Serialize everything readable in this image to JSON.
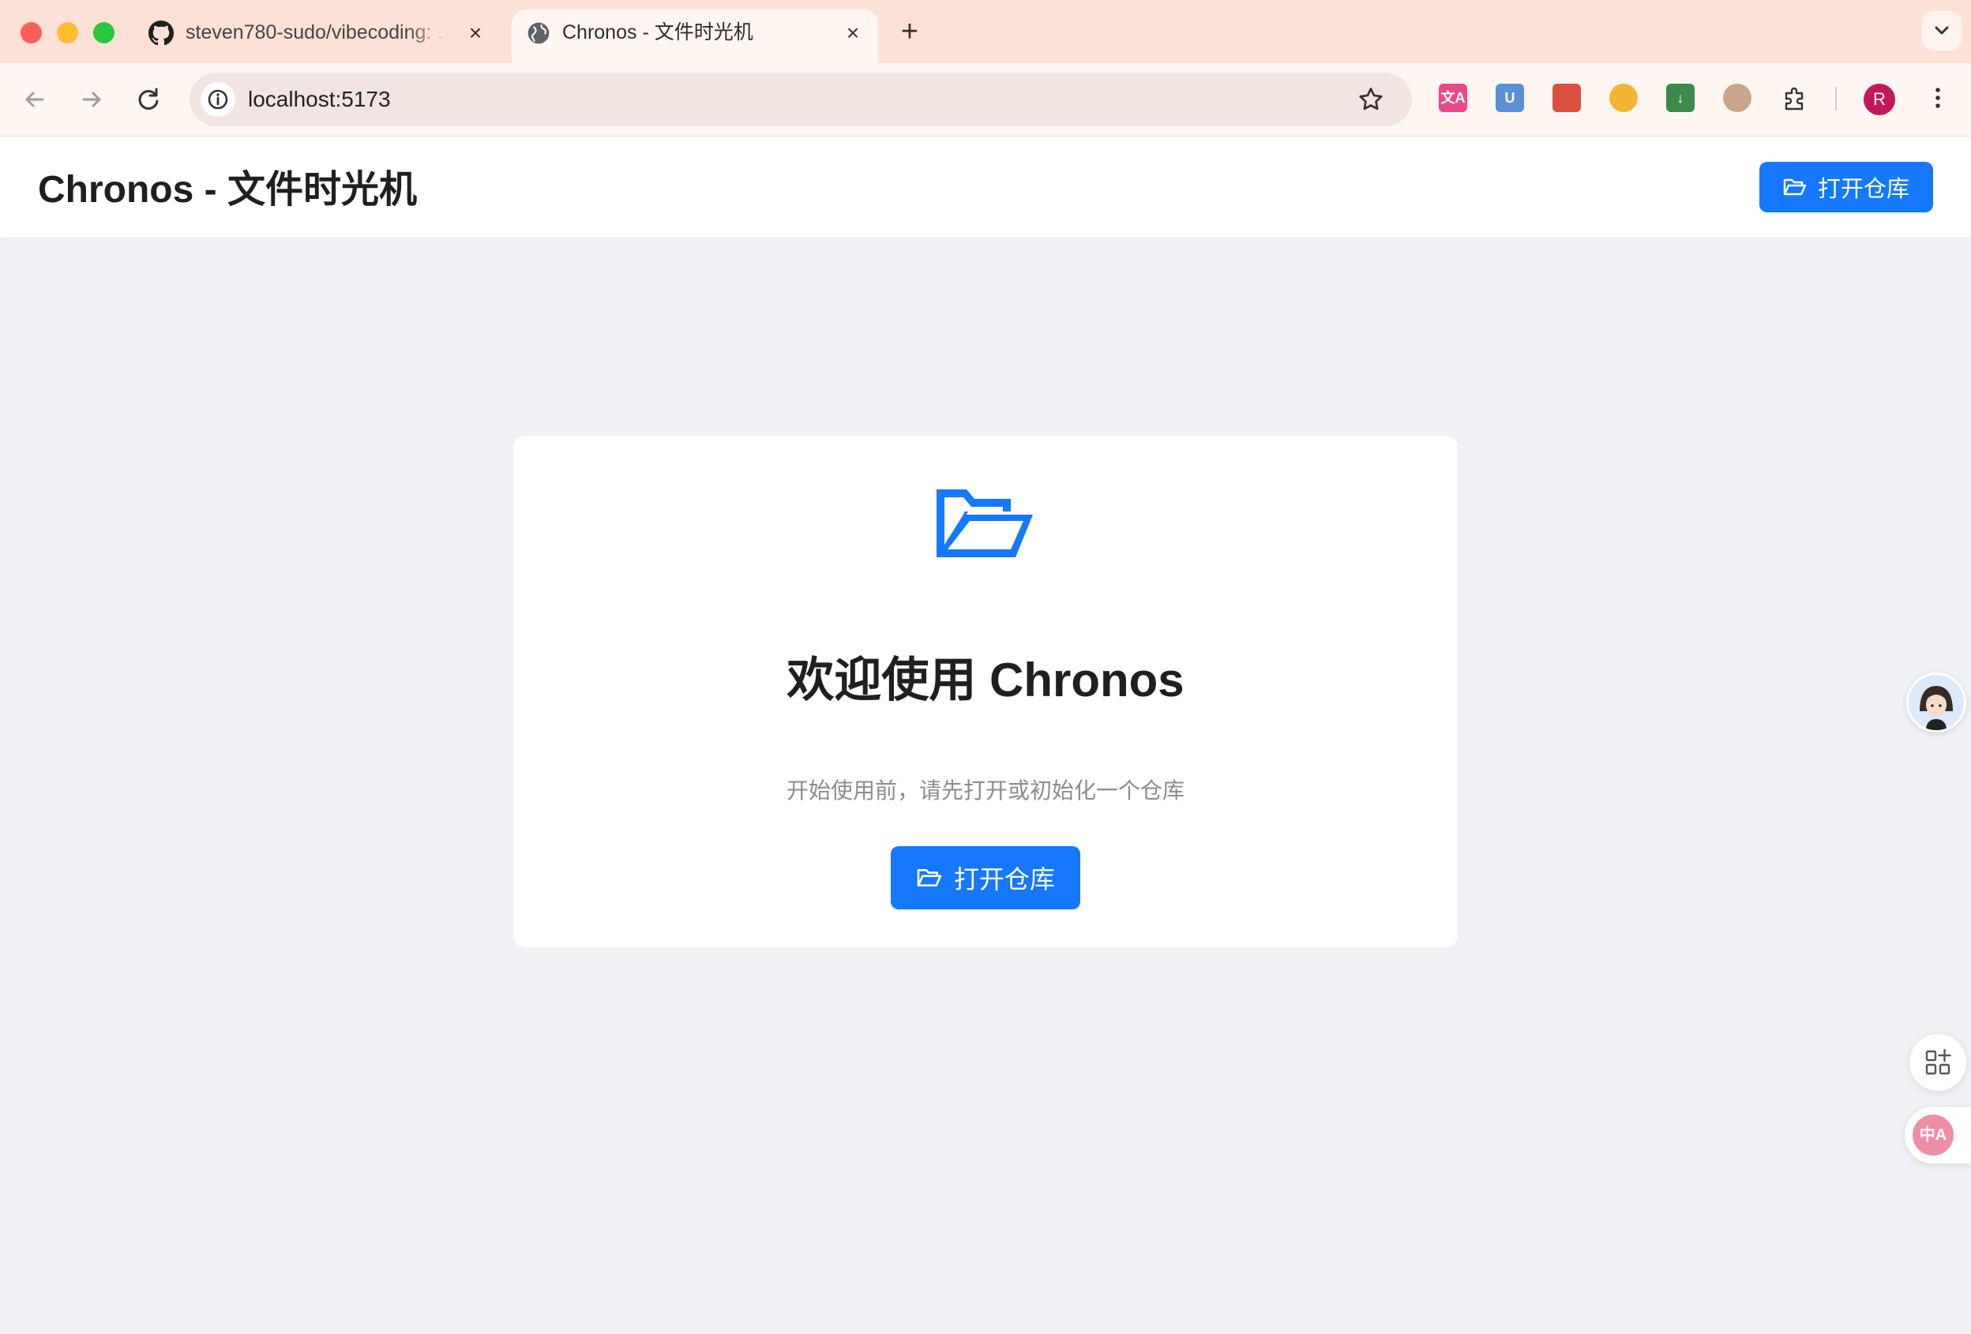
{
  "browser": {
    "tabs": [
      {
        "title": "steven780-sudo/vibecoding: …",
        "active": false,
        "favicon": "github-icon"
      },
      {
        "title": "Chronos - 文件时光机",
        "active": true,
        "favicon": "globe-icon"
      }
    ],
    "url": "localhost:5173",
    "profile_initial": "R",
    "extensions": [
      "translate-icon",
      "u-extension-icon",
      "bird-extension-icon",
      "cat-extension-icon",
      "download-extension-icon",
      "avatar-extension-icon"
    ]
  },
  "app": {
    "title": "Chronos - 文件时光机",
    "header_button_label": "打开仓库"
  },
  "welcome": {
    "title": "欢迎使用 Chronos",
    "description": "开始使用前，请先打开或初始化一个仓库",
    "button_label": "打开仓库"
  },
  "floating": {
    "translate_label": "中A"
  },
  "colors": {
    "primary": "#1677ff",
    "tabstrip": "#fde0d6",
    "page_bg": "#f0f1f5"
  }
}
